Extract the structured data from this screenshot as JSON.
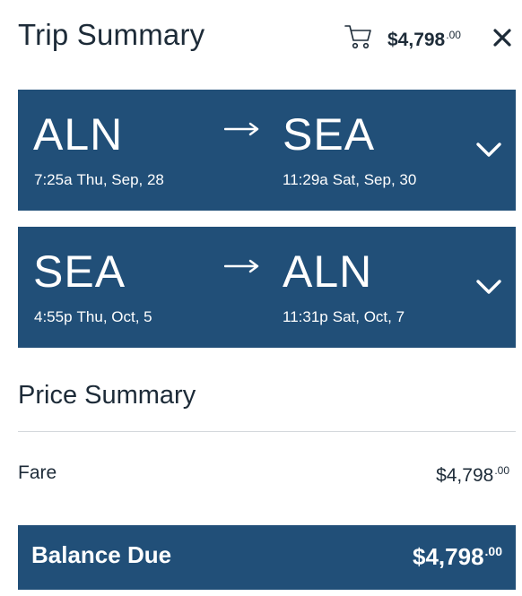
{
  "header": {
    "title": "Trip Summary",
    "cart_total_main": "$4,798",
    "cart_total_cents": ".00",
    "cart_icon": "shopping-cart-icon",
    "close_icon": "close-x-icon"
  },
  "flights": [
    {
      "from_code": "ALN",
      "to_code": "SEA",
      "depart_time": "7:25a",
      "depart_date": "Thu, Sep, 28",
      "arrive_time": "11:29a",
      "arrive_date": "Sat, Sep, 30"
    },
    {
      "from_code": "SEA",
      "to_code": "ALN",
      "depart_time": "4:55p",
      "depart_date": "Thu, Oct, 5",
      "arrive_time": "11:31p",
      "arrive_date": "Sat, Oct, 7"
    }
  ],
  "price_summary": {
    "title": "Price Summary",
    "fare_label": "Fare",
    "fare_main": "$4,798",
    "fare_cents": ".00",
    "balance_label": "Balance Due",
    "balance_main": "$4,798",
    "balance_cents": ".00"
  },
  "colors": {
    "accent": "#214f78",
    "text": "#1d2b38",
    "divider": "#d4d8dc"
  }
}
